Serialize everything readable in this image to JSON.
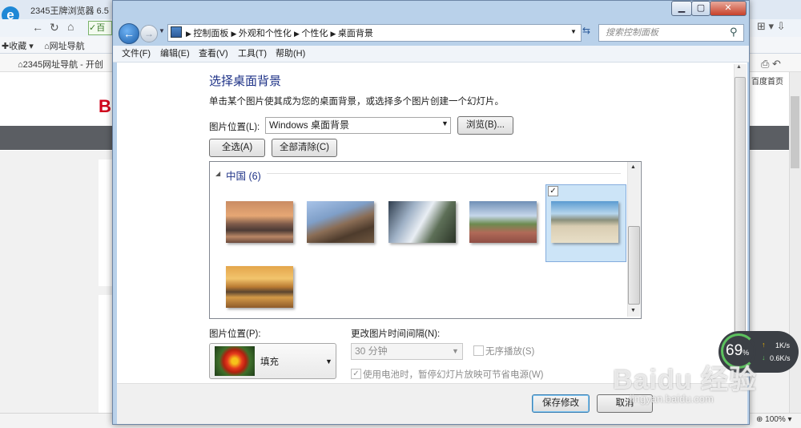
{
  "background_browser": {
    "title": "2345王牌浏览器 6.5",
    "favorites_label": "收藏",
    "nav_label": "网址导航",
    "tab_label": "2345网址导航 - 开创",
    "home_label": "百度首页",
    "zoom": "100%",
    "badge_text": "百",
    "logo_text": "B"
  },
  "window": {
    "controls": {
      "minimize": "▁",
      "maximize": "▢",
      "close": "✕"
    },
    "breadcrumb": [
      "控制面板",
      "外观和个性化",
      "个性化",
      "桌面背景"
    ],
    "search_placeholder": "搜索控制面板",
    "menu": [
      "文件(F)",
      "编辑(E)",
      "查看(V)",
      "工具(T)",
      "帮助(H)"
    ]
  },
  "content": {
    "heading": "选择桌面背景",
    "description": "单击某个图片使其成为您的桌面背景，或选择多个图片创建一个幻灯片。",
    "picture_location_label": "图片位置(L):",
    "picture_location_value": "Windows 桌面背景",
    "browse_button": "浏览(B)...",
    "select_all_button": "全选(A)",
    "clear_all_button": "全部清除(C)",
    "group_name": "中国 (6)",
    "thumbnails": [
      {
        "name": "li-river-karst",
        "selected": false
      },
      {
        "name": "great-wall",
        "selected": false
      },
      {
        "name": "huangshan-mountains",
        "selected": false
      },
      {
        "name": "rice-terraces",
        "selected": false
      },
      {
        "name": "beach-rocks",
        "selected": true
      },
      {
        "name": "seventeen-arch-bridge",
        "selected": false
      }
    ],
    "position_label": "图片位置(P):",
    "position_value": "填充",
    "interval_label": "更改图片时间间隔(N):",
    "interval_value": "30 分钟",
    "shuffle_label": "无序播放(S)",
    "battery_label": "使用电池时，暂停幻灯片放映可节省电源(W)"
  },
  "footer": {
    "save_button": "保存修改",
    "cancel_button": "取消"
  },
  "net_widget": {
    "percent": "69",
    "percent_unit": "%",
    "upload": "1K/s",
    "download": "0.6K/s"
  },
  "watermark": {
    "main": "Baidu 经验",
    "sub": "jingyan.baidu.com"
  },
  "colors": {
    "heading": "#1e3287",
    "selection": "#cce4f7",
    "window_frame": "#b9d1ea"
  }
}
